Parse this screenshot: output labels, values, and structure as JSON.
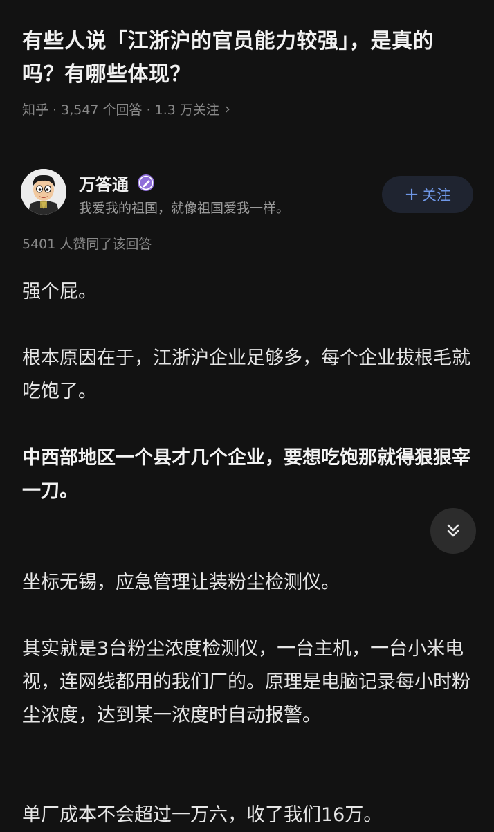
{
  "question": {
    "title": "有些人说「江浙沪的官员能力较强」，是真的吗？有哪些体现？",
    "meta": "知乎 · 3,547 个回答 · 1.3 万关注",
    "chevron_icon": "chevron-right-icon"
  },
  "author": {
    "name": "万答通",
    "badge_icon": "pen-badge-icon",
    "bio": "我爱我的祖国，就像祖国爱我一样。",
    "follow_label": "关注"
  },
  "answer": {
    "vote_line": "5401 人赞同了该回答",
    "paragraphs": [
      "强个屁。",
      "根本原因在于，江浙沪企业足够多，每个企业拔根毛就吃饱了。",
      "中西部地区一个县才几个企业，要想吃饱那就得狠狠宰一刀。",
      "坐标无锡，应急管理让装粉尘检测仪。",
      "其实就是3台粉尘浓度检测仪，一台主机，一台小米电视，连网线都用的我们厂的。原理是电脑记录每小时粉尘浓度，达到某一浓度时自动报警。",
      "单厂成本不会超过一万六，收了我们16万。"
    ]
  },
  "colors": {
    "background": "#121212",
    "follow_text": "#6f97e6",
    "badge": "#8f6fd9"
  }
}
